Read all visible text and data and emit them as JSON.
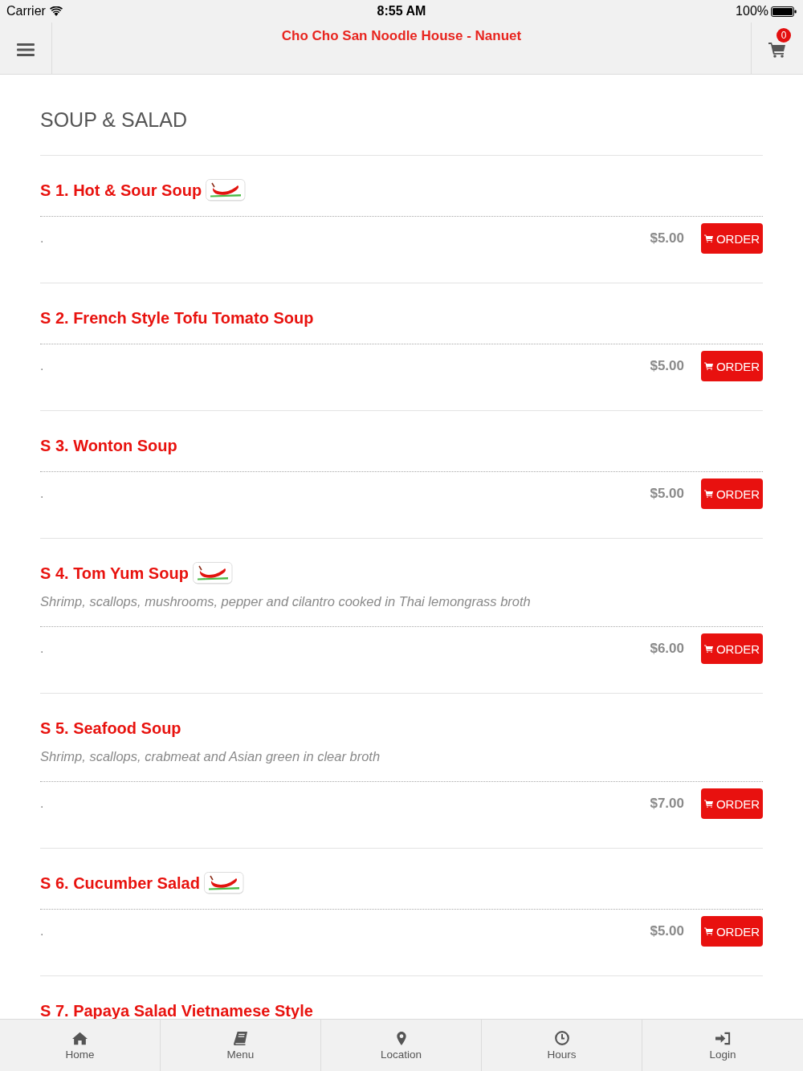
{
  "status_bar": {
    "carrier": "Carrier",
    "time": "8:55 AM",
    "battery": "100%"
  },
  "header": {
    "title": "Cho Cho San Noodle House - Nanuet",
    "cart_count": "0"
  },
  "section": {
    "title": "SOUP & SALAD"
  },
  "items": [
    {
      "name": "S 1. Hot & Sour Soup",
      "spicy": true,
      "note": ".",
      "price": "$5.00",
      "button": "ORDER"
    },
    {
      "name": "S 2. French Style Tofu Tomato Soup",
      "spicy": false,
      "note": ".",
      "price": "$5.00",
      "button": "ORDER"
    },
    {
      "name": "S 3. Wonton Soup",
      "spicy": false,
      "note": ".",
      "price": "$5.00",
      "button": "ORDER"
    },
    {
      "name": "S 4. Tom Yum Soup",
      "spicy": true,
      "description": "Shrimp, scallops, mushrooms, pepper and cilantro cooked in Thai lemongrass broth",
      "note": ".",
      "price": "$6.00",
      "button": "ORDER"
    },
    {
      "name": "S 5. Seafood Soup",
      "spicy": false,
      "description": "Shrimp, scallops, crabmeat and Asian green in clear broth",
      "note": ".",
      "price": "$7.00",
      "button": "ORDER"
    },
    {
      "name": "S 6. Cucumber Salad",
      "spicy": true,
      "note": ".",
      "price": "$5.00",
      "button": "ORDER"
    },
    {
      "name": "S 7. Papaya Salad Vietnamese Style",
      "spicy": false
    }
  ],
  "tab_bar": [
    {
      "label": "Home",
      "kind": "home"
    },
    {
      "label": "Menu",
      "kind": "book"
    },
    {
      "label": "Location",
      "kind": "pin"
    },
    {
      "label": "Hours",
      "kind": "clock"
    },
    {
      "label": "Login",
      "kind": "login"
    }
  ]
}
